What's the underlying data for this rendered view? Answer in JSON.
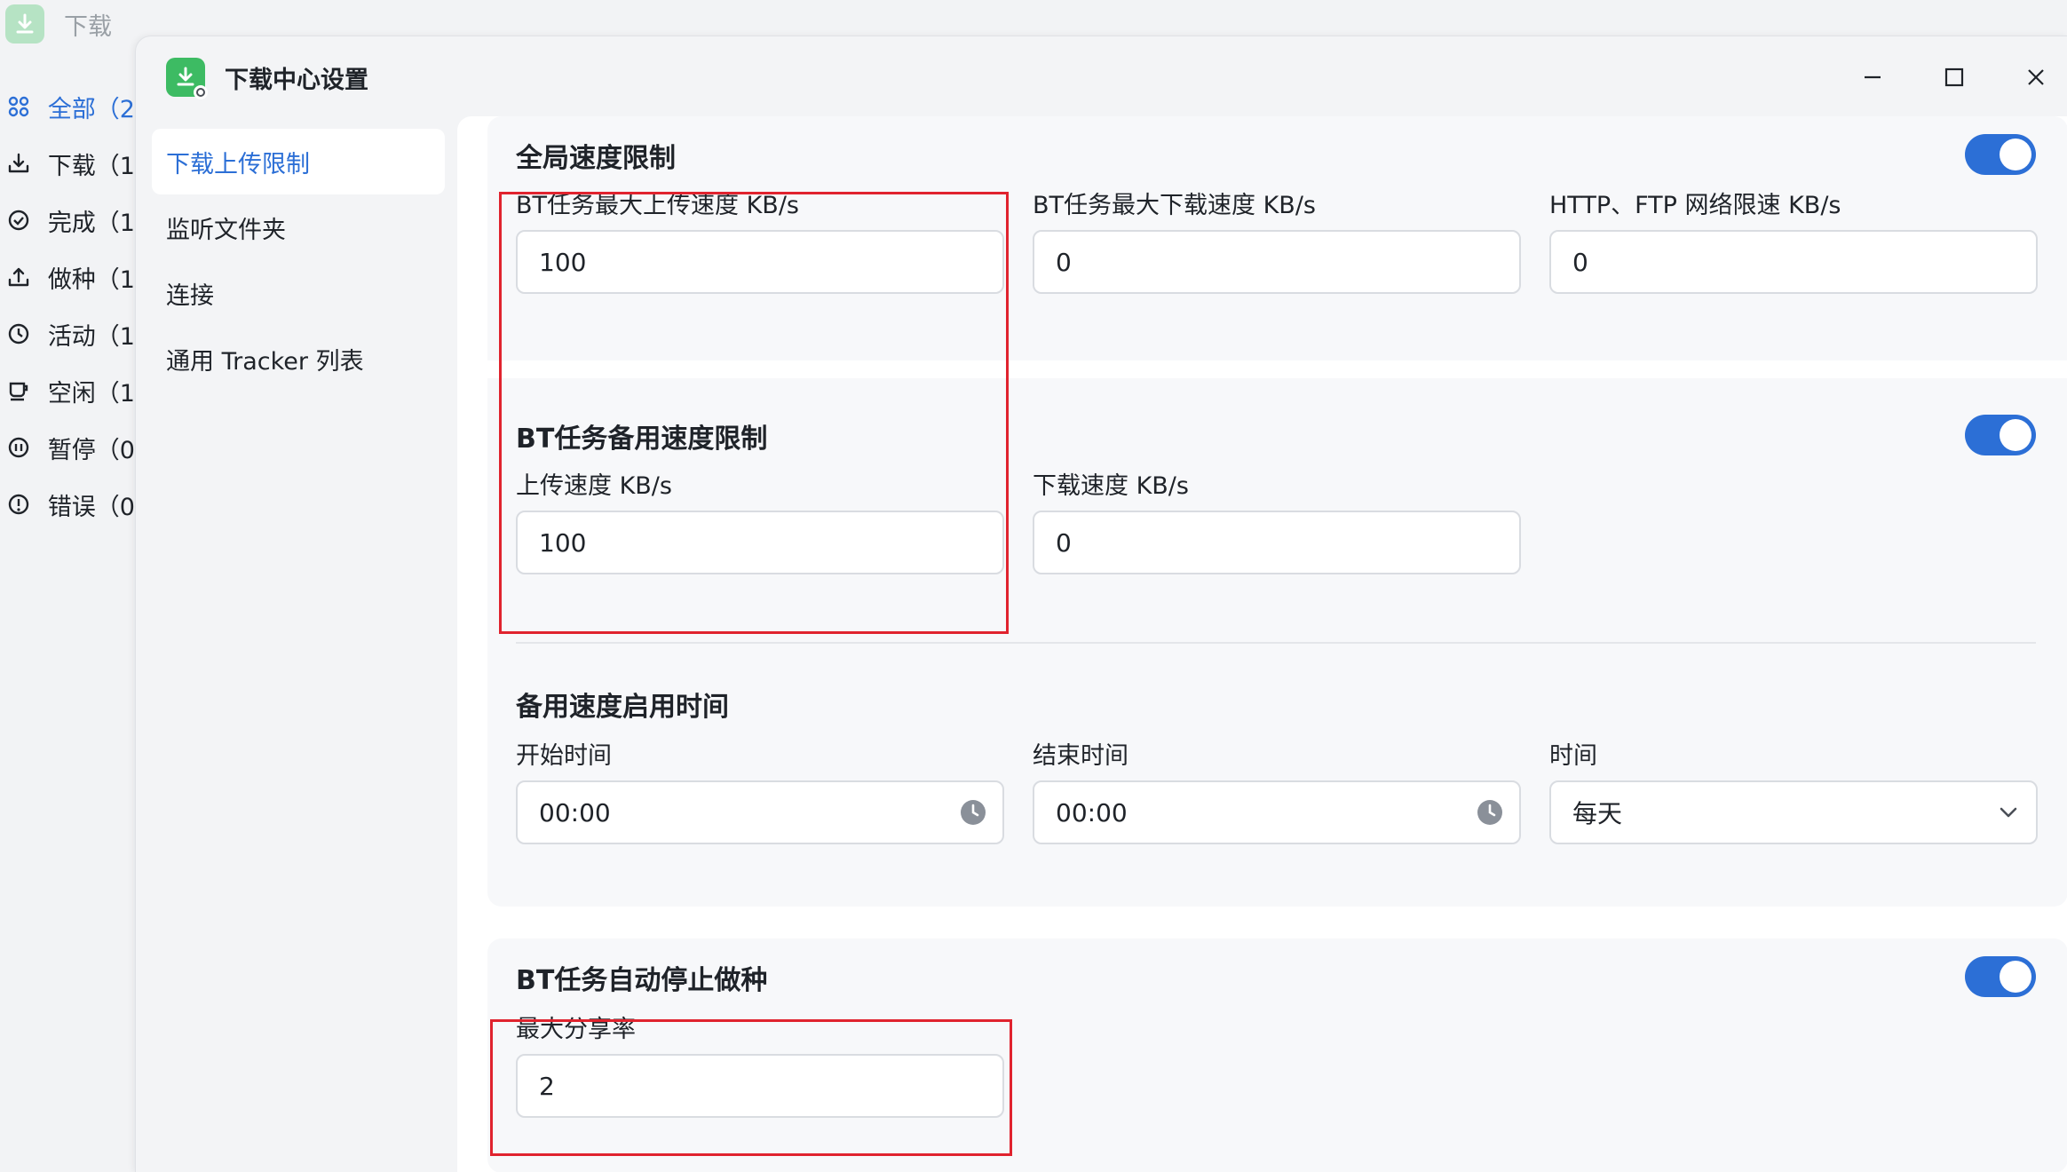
{
  "app": {
    "title": "下载",
    "nav": [
      {
        "label": "全部（2",
        "icon": "grid-icon",
        "active": true
      },
      {
        "label": "下载（1",
        "icon": "download-icon"
      },
      {
        "label": "完成（1",
        "icon": "check-circle-icon"
      },
      {
        "label": "做种（1",
        "icon": "upload-icon"
      },
      {
        "label": "活动（1",
        "icon": "activity-icon"
      },
      {
        "label": "空闲（1",
        "icon": "cup-icon"
      },
      {
        "label": "暂停（0",
        "icon": "pause-icon"
      },
      {
        "label": "错误（0",
        "icon": "error-icon"
      }
    ]
  },
  "dialog": {
    "title": "下载中心设置",
    "sidebar": [
      {
        "label": "下载上传限制",
        "active": true
      },
      {
        "label": "监听文件夹"
      },
      {
        "label": "连接"
      },
      {
        "label": "通用 Tracker 列表"
      }
    ]
  },
  "global_limit": {
    "title": "全局速度限制",
    "enabled": true,
    "upload_label": "BT任务最大上传速度 KB/s",
    "upload_value": "100",
    "download_label": "BT任务最大下载速度 KB/s",
    "download_value": "0",
    "http_label": "HTTP、FTP 网络限速 KB/s",
    "http_value": "0"
  },
  "backup_limit": {
    "title": "BT任务备用速度限制",
    "enabled": true,
    "upload_label": "上传速度 KB/s",
    "upload_value": "100",
    "download_label": "下载速度 KB/s",
    "download_value": "0"
  },
  "backup_schedule": {
    "title": "备用速度启用时间",
    "start_label": "开始时间",
    "start_value": "00:00",
    "end_label": "结束时间",
    "end_value": "00:00",
    "time_label": "时间",
    "time_value": "每天"
  },
  "auto_stop": {
    "title": "BT任务自动停止做种",
    "enabled": true,
    "ratio_label": "最大分享率",
    "ratio_value": "2"
  },
  "colors": {
    "accent": "#2c6fd6",
    "highlight": "#e0232e"
  }
}
